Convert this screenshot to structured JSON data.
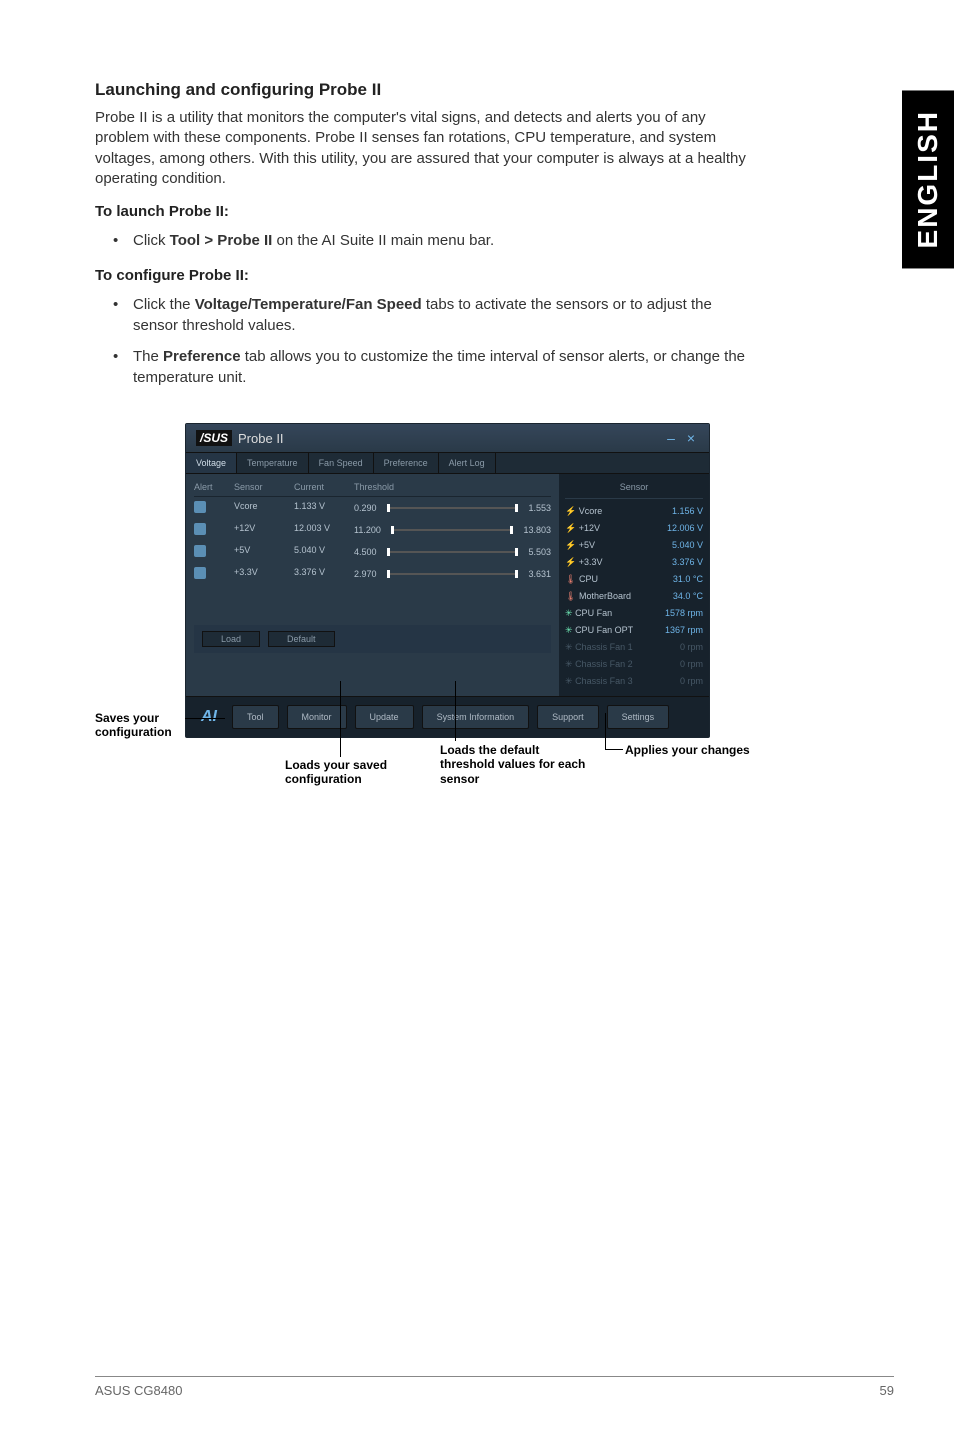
{
  "sidebar": {
    "lang": "ENGLISH"
  },
  "heading": "Launching and configuring Probe II",
  "intro": "Probe II is a utility that monitors the computer's vital signs, and detects and alerts you of any problem with these components. Probe II senses fan rotations, CPU temperature, and system voltages, among others. With this utility, you are assured that your computer is always at a healthy operating condition.",
  "launch": {
    "title": "To launch Probe II:",
    "item": "Click Tool > Probe II on the AI Suite II main menu bar."
  },
  "configure": {
    "title": "To configure Probe II:",
    "item1_pre": "Click the ",
    "item1_bold": "Voltage/Temperature/Fan Speed",
    "item1_post": " tabs to activate the sensors or to adjust the sensor threshold values.",
    "item2_pre": "The ",
    "item2_bold": "Preference",
    "item2_post": " tab allows you to customize the time interval of sensor alerts, or change the temperature unit."
  },
  "window": {
    "brand": "/SUS",
    "title": "Probe II",
    "min": "–",
    "close": "×",
    "tabs": {
      "voltage": "Voltage",
      "temperature": "Temperature",
      "fanspeed": "Fan Speed",
      "preference": "Preference",
      "alertlog": "Alert Log"
    },
    "cols": {
      "alert": "Alert",
      "sensor": "Sensor",
      "current": "Current",
      "threshold": "Threshold"
    },
    "rows": [
      {
        "sensor": "Vcore",
        "current": "1.133 V",
        "low": "0.290",
        "high": "1.553"
      },
      {
        "sensor": "+12V",
        "current": "12.003 V",
        "low": "11.200",
        "high": "13.803"
      },
      {
        "sensor": "+5V",
        "current": "5.040 V",
        "low": "4.500",
        "high": "5.503"
      },
      {
        "sensor": "+3.3V",
        "current": "3.376 V",
        "low": "2.970",
        "high": "3.631"
      }
    ],
    "load_label": "Load",
    "default_label": "Default",
    "sensor_panel": {
      "title": "Sensor",
      "items": [
        {
          "icon": "bolt",
          "name": "Vcore",
          "val": "1.156 V"
        },
        {
          "icon": "bolt",
          "name": "+12V",
          "val": "12.006 V"
        },
        {
          "icon": "bolt",
          "name": "+5V",
          "val": "5.040 V"
        },
        {
          "icon": "bolt",
          "name": "+3.3V",
          "val": "3.376 V"
        },
        {
          "icon": "temp",
          "name": "CPU",
          "val": "31.0 °C"
        },
        {
          "icon": "temp",
          "name": "MotherBoard",
          "val": "34.0 °C"
        },
        {
          "icon": "fan",
          "name": "CPU Fan",
          "val": "1578 rpm"
        },
        {
          "icon": "fan",
          "name": "CPU Fan OPT",
          "val": "1367 rpm"
        },
        {
          "icon": "dim",
          "name": "Chassis Fan 1",
          "val": "0 rpm"
        },
        {
          "icon": "dim",
          "name": "Chassis Fan 2",
          "val": "0 rpm"
        },
        {
          "icon": "dim",
          "name": "Chassis Fan 3",
          "val": "0 rpm"
        }
      ]
    },
    "bottom": {
      "tool": "Tool",
      "monitor": "Monitor",
      "update": "Update",
      "sysinfo": "System Information",
      "support": "Support",
      "settings": "Settings"
    }
  },
  "callouts": {
    "saves": "Saves your configuration",
    "loads_saved": "Loads your saved configuration",
    "loads_default": "Loads the default threshold values for each sensor",
    "applies": "Applies your changes"
  },
  "footer": {
    "left": "ASUS CG8480",
    "right": "59"
  }
}
